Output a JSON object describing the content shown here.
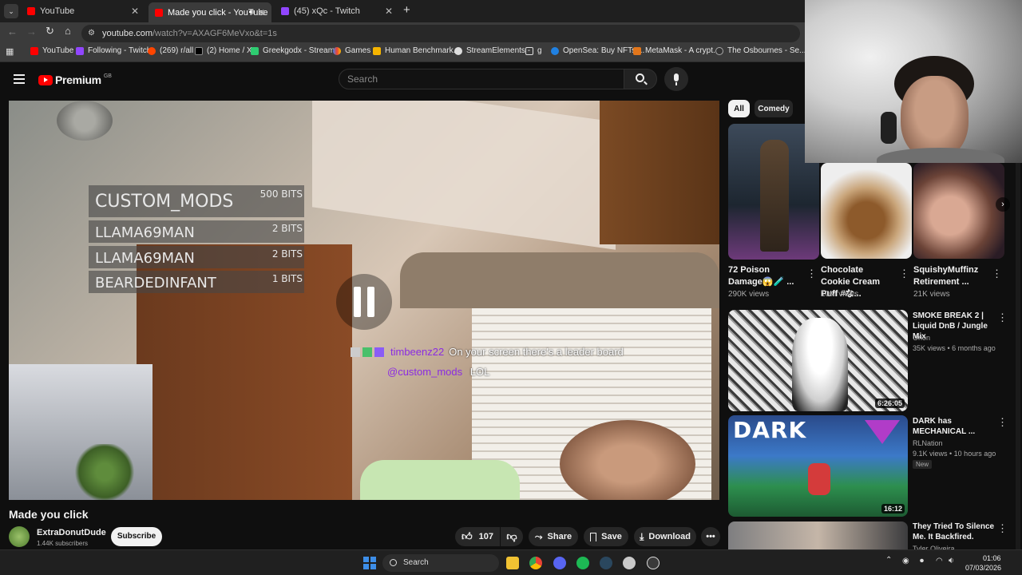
{
  "browser": {
    "tabs": [
      {
        "label": "YouTube",
        "active": false
      },
      {
        "label": "Made you click - YouTube",
        "active": true
      },
      {
        "label": "(45) xQc - Twitch",
        "active": false
      }
    ],
    "new_tab_icon": "plus-icon",
    "url_host": "youtube.com",
    "url_path": "/watch?v=AXAGF6MeVxo&t=1s",
    "bookmarks": [
      "YouTube",
      "Following - Twitch",
      "(269) r/all",
      "(2) Home / X",
      "Greekgodx - Stream...",
      "Games",
      "Human Benchmark...",
      "StreamElements -",
      "g",
      "OpenSea: Buy NFTs,...",
      "MetaMask - A crypt...",
      "The Osbournes - Se..."
    ]
  },
  "youtube": {
    "logo_text": "Premium",
    "logo_superscript": "GB",
    "search_placeholder": "Search"
  },
  "video": {
    "leaderboard": [
      {
        "name": "CUSTOM_MODS",
        "bits": "500 BITS"
      },
      {
        "name": "LLAMA69MAN",
        "bits": "2 BITS"
      },
      {
        "name": "LLAMA69MAN",
        "bits": "2 BITS"
      },
      {
        "name": "BEARDEDINFANT",
        "bits": "1 BITS"
      }
    ],
    "chat": [
      {
        "user": "timbeenz22",
        "message": "On your screen there's a leader board"
      },
      {
        "user": "@custom_mods",
        "message": "LOL"
      }
    ],
    "title": "Made you click",
    "channel": "ExtraDonutDude",
    "subscribers": "1.44K subscribers",
    "subscribe_label": "Subscribe",
    "likes": "107",
    "share_label": "Share",
    "save_label": "Save",
    "download_label": "Download"
  },
  "sidebar": {
    "chips": [
      "All",
      "Comedy"
    ],
    "shorts": [
      {
        "title": "72 Poison Damage😱🧪 ...",
        "views": "290K views"
      },
      {
        "title": "Chocolate Cookie Cream Puff #な...",
        "views": "10M views"
      },
      {
        "title": "SquishyMuffinz Retirement ...",
        "views": "21K views"
      }
    ],
    "videos": [
      {
        "title": "SMOKE BREAK 2 | Liquid DnB / Jungle Mix",
        "channel": "Orion",
        "meta": "35K views • 6 months ago",
        "duration": "6:26:05",
        "badge": ""
      },
      {
        "title": "DARK has MECHANICAL ...",
        "channel": "RLNation",
        "meta": "9.1K views • 10 hours ago",
        "duration": "16:12",
        "badge": "New",
        "thumb_text": "DARK"
      },
      {
        "title": "They Tried To Silence Me. It Backfired.",
        "channel": "Tyler Oliveira",
        "meta": "",
        "duration": "",
        "badge": ""
      }
    ]
  },
  "taskbar": {
    "search_label": "Search",
    "time": "01:06",
    "date": "07/03/2026"
  },
  "colors": {
    "yt_red": "#ff0000",
    "twitch_purple": "#9146ff",
    "chat_username": "#8a2be2"
  }
}
